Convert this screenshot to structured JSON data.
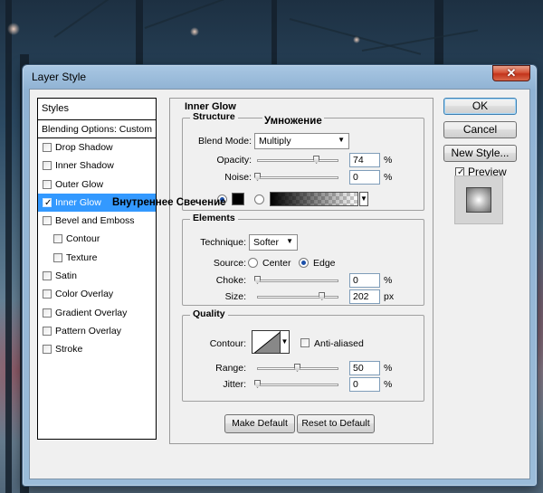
{
  "dialog": {
    "title": "Layer Style",
    "close_glyph": "✕"
  },
  "styles_panel": {
    "header": "Styles",
    "blending_options": "Blending Options: Custom",
    "items": [
      {
        "label": "Drop Shadow",
        "checked": false,
        "sub": false,
        "active": false
      },
      {
        "label": "Inner Shadow",
        "checked": false,
        "sub": false,
        "active": false
      },
      {
        "label": "Outer Glow",
        "checked": false,
        "sub": false,
        "active": false
      },
      {
        "label": "Inner Glow",
        "checked": true,
        "sub": false,
        "active": true
      },
      {
        "label": "Bevel and Emboss",
        "checked": false,
        "sub": false,
        "active": false
      },
      {
        "label": "Contour",
        "checked": false,
        "sub": true,
        "active": false
      },
      {
        "label": "Texture",
        "checked": false,
        "sub": true,
        "active": false
      },
      {
        "label": "Satin",
        "checked": false,
        "sub": false,
        "active": false
      },
      {
        "label": "Color Overlay",
        "checked": false,
        "sub": false,
        "active": false
      },
      {
        "label": "Gradient Overlay",
        "checked": false,
        "sub": false,
        "active": false
      },
      {
        "label": "Pattern Overlay",
        "checked": false,
        "sub": false,
        "active": false
      },
      {
        "label": "Stroke",
        "checked": false,
        "sub": false,
        "active": false
      }
    ],
    "annotation_inner_glow": "Внутреннее Свечение"
  },
  "inner_glow": {
    "section_title": "Inner Glow",
    "structure": {
      "title": "Structure",
      "annotation_blend": "Умножение",
      "blend_mode_label": "Blend Mode:",
      "blend_mode_value": "Multiply",
      "opacity_label": "Opacity:",
      "opacity_value": "74",
      "opacity_fraction": 0.74,
      "noise_label": "Noise:",
      "noise_value": "0",
      "noise_fraction": 0.0,
      "percent": "%",
      "color_mode": "color",
      "glow_color": "#000000"
    },
    "elements": {
      "title": "Elements",
      "technique_label": "Technique:",
      "technique_value": "Softer",
      "source_label": "Source:",
      "source_center": "Center",
      "source_edge": "Edge",
      "source_selected": "Edge",
      "choke_label": "Choke:",
      "choke_value": "0",
      "choke_fraction": 0.0,
      "size_label": "Size:",
      "size_value": "202",
      "size_fraction": 0.81,
      "size_unit": "px",
      "percent": "%"
    },
    "quality": {
      "title": "Quality",
      "contour_label": "Contour:",
      "anti_aliased_label": "Anti-aliased",
      "anti_aliased": false,
      "range_label": "Range:",
      "range_value": "50",
      "range_fraction": 0.5,
      "jitter_label": "Jitter:",
      "jitter_value": "0",
      "jitter_fraction": 0.0,
      "percent": "%"
    },
    "make_default": "Make Default",
    "reset_default": "Reset to Default"
  },
  "buttons": {
    "ok": "OK",
    "cancel": "Cancel",
    "new_style": "New Style...",
    "preview_label": "Preview",
    "preview_checked": true
  }
}
